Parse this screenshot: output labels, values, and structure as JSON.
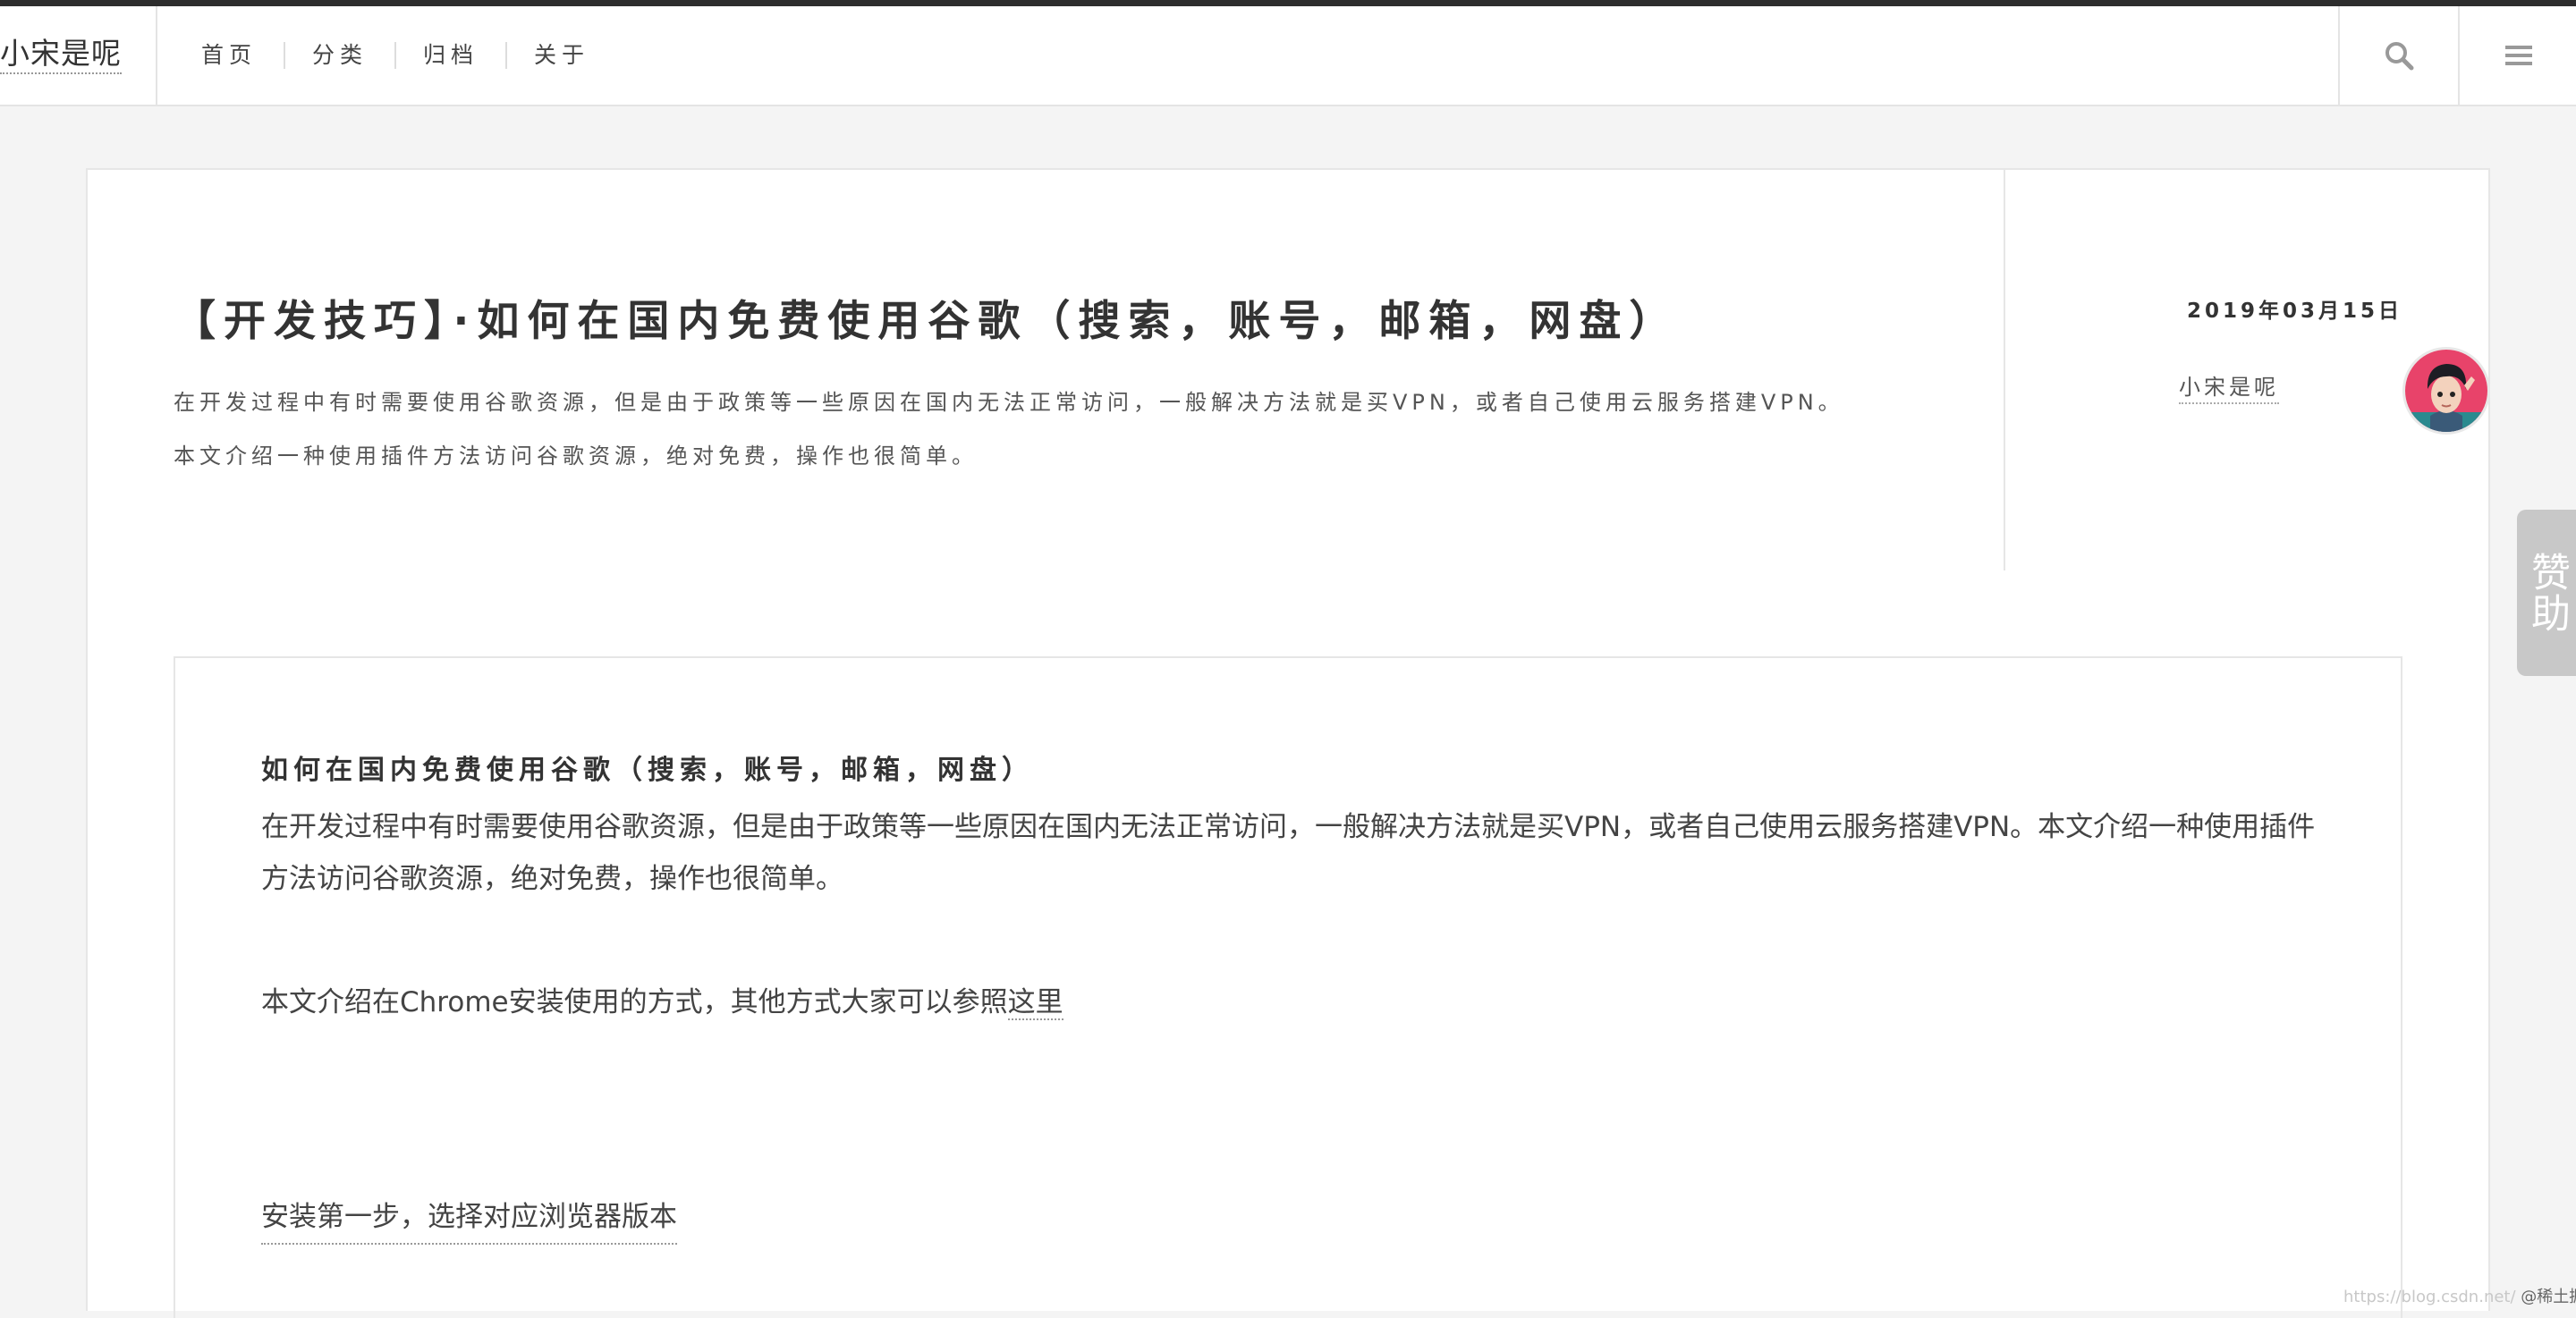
{
  "header": {
    "brand": "小宋是呢",
    "nav": [
      "首页",
      "分类",
      "归档",
      "关于"
    ],
    "search_icon": "search-icon",
    "menu_icon": "hamburger-menu-icon"
  },
  "post": {
    "title": "【开发技巧】·如何在国内免费使用谷歌（搜索，账号，邮箱，网盘）",
    "excerpt_line1": "在开发过程中有时需要使用谷歌资源，但是由于政策等一些原因在国内无法正常访问，一般解决方法就是买VPN，或者自己使用云服务搭建VPN。",
    "excerpt_line2": "本文介绍一种使用插件方法访问谷歌资源，绝对免费，操作也很简单。",
    "date": "2019年03月15日",
    "author": "小宋是呢"
  },
  "content": {
    "heading": "如何在国内免费使用谷歌（搜索，账号，邮箱，网盘）",
    "paragraph1": "在开发过程中有时需要使用谷歌资源，但是由于政策等一些原因在国内无法正常访问，一般解决方法就是买VPN，或者自己使用云服务搭建VPN。本文介绍一种使用插件方法访问谷歌资源，绝对免费，操作也很简单。",
    "paragraph2_prefix": "本文介绍在Chrome安装使用的方式，其他方式大家可以参照",
    "paragraph2_link": "这里",
    "step1": "安装第一步，选择对应浏览器版本"
  },
  "donate": "赞助",
  "watermark": {
    "url": "https://blog.csdn.net/",
    "label": "@稀土掘金技术社区"
  },
  "colors": {
    "top_strip": "#2d2d2d",
    "background": "#f4f4f4",
    "card": "#ffffff",
    "donate_tab": "#c8c8c8"
  }
}
